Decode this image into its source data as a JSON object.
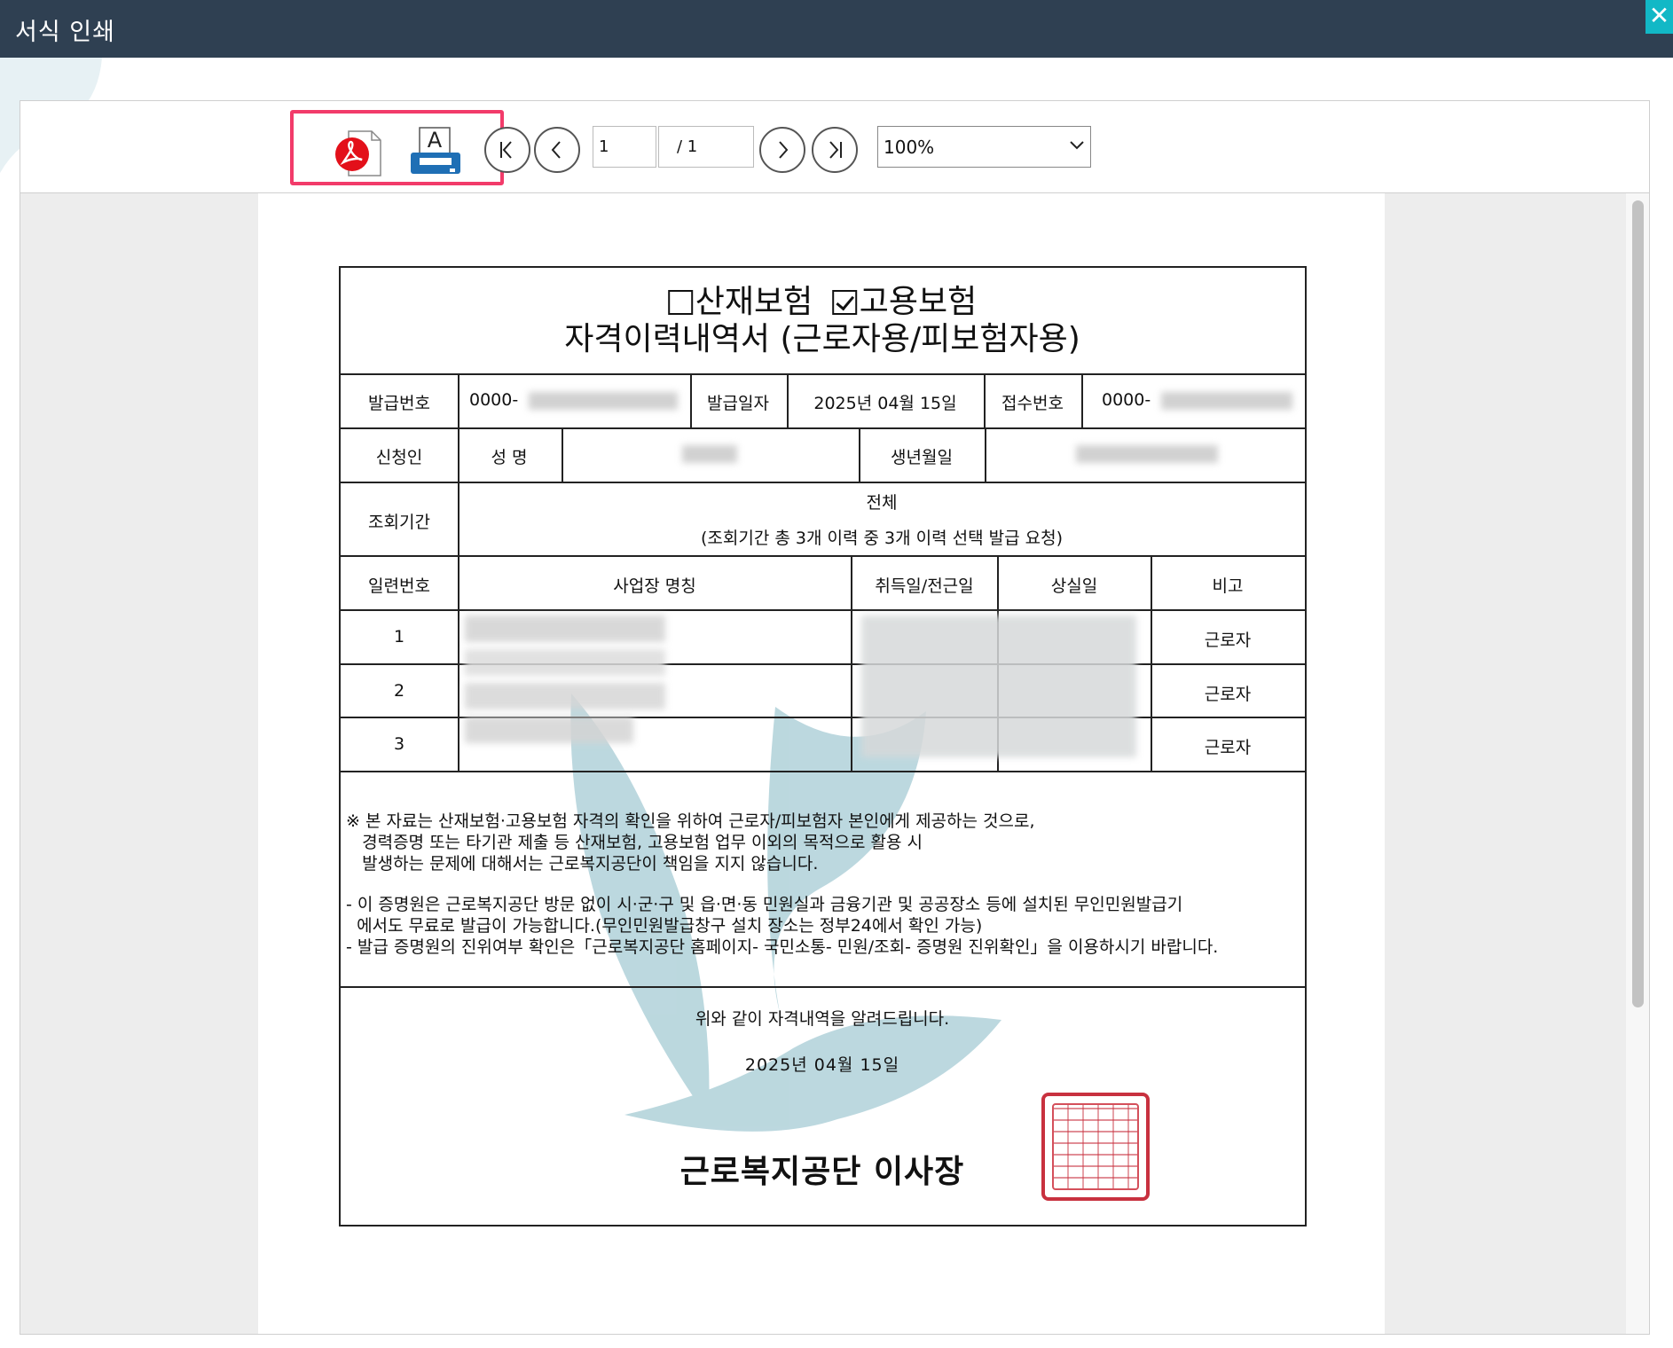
{
  "window": {
    "title": "서식 인쇄",
    "close_label": "✕"
  },
  "toolbar": {
    "page_current": "1",
    "page_total": "/ 1",
    "zoom_value": "100%",
    "print_icon_letter": "A"
  },
  "document": {
    "title_line1_opt1": "산재보험",
    "title_line1_opt2": "고용보험",
    "title_line2": "자격이력내역서 (근로자용/피보험자용)",
    "insurance_options": [
      {
        "label": "산재보험",
        "checked": false
      },
      {
        "label": "고용보험",
        "checked": true
      }
    ],
    "issue_no_label": "발급번호",
    "issue_no_prefix": "0000-",
    "issue_date_label": "발급일자",
    "issue_date": "2025년 04월 15일",
    "receipt_no_label": "접수번호",
    "receipt_no_prefix": "0000-",
    "applicant_label": "신청인",
    "name_label": "성 명",
    "birth_label": "생년월일",
    "period_label": "조회기간",
    "period_value": "전체",
    "period_note": "(조회기간 총  3개 이력 중 3개 이력 선택 발급 요청)",
    "table_headers": {
      "serial": "일련번호",
      "workplace": "사업장 명칭",
      "acquired": "취득일/전근일",
      "lost": "상실일",
      "remark": "비고"
    },
    "rows": [
      {
        "serial": "1",
        "remark": "근로자"
      },
      {
        "serial": "2",
        "remark": "근로자"
      },
      {
        "serial": "3",
        "remark": "근로자"
      }
    ],
    "notice_1": "※ 본 자료는 산재보험·고용보험 자격의 확인을 위하여 근로자/피보험자 본인에게 제공하는 것으로,\n   경력증명 또는 타기관 제출 등 산재보험, 고용보험 업무 이외의 목적으로 활용 시\n   발생하는 문제에 대해서는 근로복지공단이 책임을 지지 않습니다.",
    "notice_2": "- 이 증명원은 근로복지공단 방문 없이 시·군·구 및 읍·면·동 민원실과 금융기관 및 공공장소 등에 설치된 무인민원발급기\n  에서도 무료로 발급이 가능합니다.(무인민원발급창구 설치 장소는 정부24에서 확인 가능)\n- 발급 증명원의 진위여부 확인은「근로복지공단 홈페이지- 국민소통- 민원/조회- 증명원 진위확인」을 이용하시기 바랍니다.",
    "closing": "위와 같이 자격내역을 알려드립니다.",
    "closing_date": "2025년 04월 15일",
    "signer": "근로복지공단  이사장"
  },
  "colors": {
    "titlebar": "#2f4052",
    "close_button": "#12b8c6",
    "highlight": "#f23b6a",
    "watermark": "#6aa9b8",
    "seal": "#c8313f",
    "pdf_red": "#e3101a",
    "printer_blue": "#1f6fb5"
  },
  "icons": [
    "pdf-icon",
    "print-icon",
    "first-page-icon",
    "prev-page-icon",
    "next-page-icon",
    "last-page-icon",
    "chevron-down-icon",
    "close-icon"
  ]
}
